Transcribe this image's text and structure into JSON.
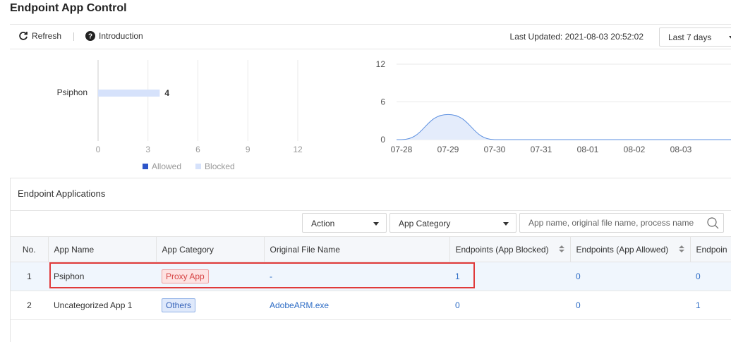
{
  "page": {
    "title": "Endpoint App Control"
  },
  "toolbar": {
    "refresh_label": "Refresh",
    "intro_label": "Introduction",
    "last_updated": "Last Updated: 2021-08-03 20:52:02",
    "range_selected": "Last 7 days"
  },
  "bar_chart": {
    "category": "Psiphon",
    "value_label": "4",
    "ticks": [
      "0",
      "3",
      "6",
      "9",
      "12"
    ],
    "legend": {
      "allowed": "Allowed",
      "blocked": "Blocked"
    },
    "colors": {
      "allowed": "#2d55c9",
      "blocked": "#d6e2fb"
    }
  },
  "chart_data": [
    {
      "type": "bar",
      "orientation": "horizontal",
      "categories": [
        "Psiphon"
      ],
      "series": [
        {
          "name": "Allowed",
          "values": [
            0
          ]
        },
        {
          "name": "Blocked",
          "values": [
            4
          ]
        }
      ],
      "xlim": [
        0,
        12
      ],
      "xticks": [
        0,
        3,
        6,
        9,
        12
      ],
      "legend_position": "bottom"
    },
    {
      "type": "area",
      "x": [
        "07-28",
        "07-29",
        "07-30",
        "07-31",
        "08-01",
        "08-02",
        "08-03"
      ],
      "values": [
        0,
        4,
        0,
        0,
        0,
        0,
        0
      ],
      "ylim": [
        0,
        12
      ],
      "yticks": [
        0,
        6,
        12
      ],
      "grid": true
    }
  ],
  "line_chart": {
    "yticks": [
      "12",
      "6",
      "0"
    ],
    "xticks": [
      "07-28",
      "07-29",
      "07-30",
      "07-31",
      "08-01",
      "08-02",
      "08-03"
    ]
  },
  "section": {
    "title": "Endpoint Applications"
  },
  "filters": {
    "action": "Action",
    "category": "App Category",
    "search_placeholder": "App name, original file name, process name"
  },
  "table": {
    "headers": {
      "no": "No.",
      "app_name": "App Name",
      "app_category": "App Category",
      "file_name": "Original File Name",
      "blocked": "Endpoints (App Blocked)",
      "allowed": "Endpoints (App Allowed)",
      "extra": "Endpoin"
    },
    "rows": [
      {
        "no": "1",
        "app_name": "Psiphon",
        "category": "Proxy App",
        "file": "-",
        "blocked": "1",
        "allowed": "0",
        "extra": "0"
      },
      {
        "no": "2",
        "app_name": "Uncategorized App 1",
        "category": "Others",
        "file": "AdobeARM.exe",
        "blocked": "0",
        "allowed": "0",
        "extra": "1"
      }
    ]
  }
}
